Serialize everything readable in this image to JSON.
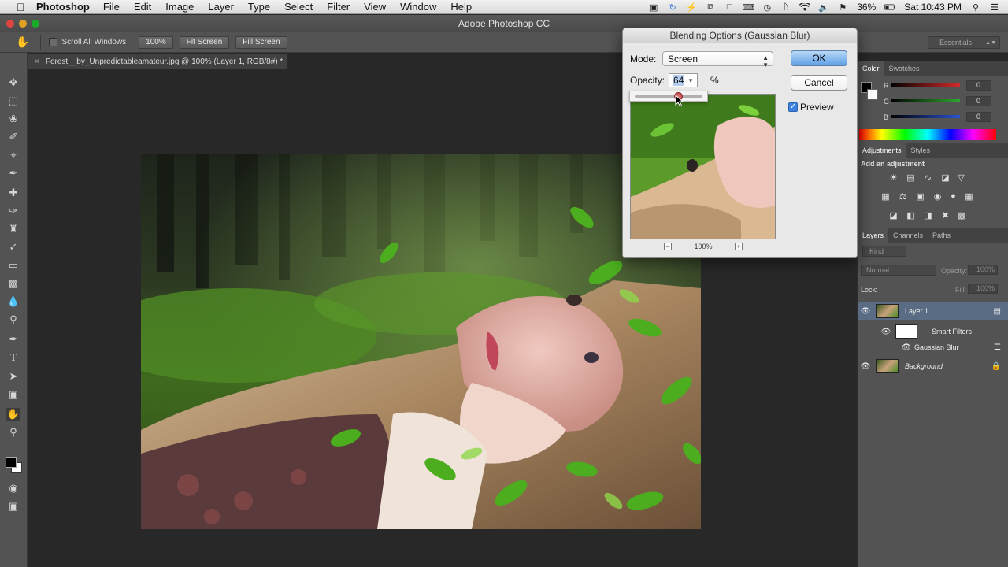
{
  "menubar": {
    "app": "Photoshop",
    "items": [
      "File",
      "Edit",
      "Image",
      "Layer",
      "Type",
      "Select",
      "Filter",
      "View",
      "Window",
      "Help"
    ],
    "battery": "36%",
    "clock": "Sat 10:43 PM"
  },
  "window": {
    "title": "Adobe Photoshop CC"
  },
  "options_bar": {
    "scroll_all_windows": "Scroll All Windows",
    "zoom_100": "100%",
    "fit_screen": "Fit Screen",
    "fill_screen": "Fill Screen",
    "workspace": "Essentials"
  },
  "document": {
    "tab_title": "Forest__by_Unpredictableamateur.jpg @ 100% (Layer 1, RGB/8#) *"
  },
  "dialog": {
    "title": "Blending Options (Gaussian Blur)",
    "mode_label": "Mode:",
    "mode_value": "Screen",
    "opacity_label": "Opacity:",
    "opacity_value": "64",
    "percent_sign": "%",
    "ok_label": "OK",
    "cancel_label": "Cancel",
    "preview_label": "Preview",
    "preview_checked": true,
    "zoom_level": "100%",
    "opacity_slider_fraction": 0.64
  },
  "color_panel": {
    "tabs": [
      "Color",
      "Swatches"
    ],
    "channels": [
      {
        "label": "R",
        "value": "0",
        "color": "#d42a2a"
      },
      {
        "label": "G",
        "value": "0",
        "color": "#2ea82e"
      },
      {
        "label": "B",
        "value": "0",
        "color": "#2a52d4"
      }
    ]
  },
  "adjustments_panel": {
    "tabs": [
      "Adjustments",
      "Styles"
    ],
    "heading": "Add an adjustment"
  },
  "layers_panel": {
    "tabs": [
      "Layers",
      "Channels",
      "Paths"
    ],
    "kind_label": "Kind",
    "blend_mode": "Normal",
    "opacity_label": "Opacity:",
    "opacity_value": "100%",
    "lock_label": "Lock:",
    "fill_label": "Fill:",
    "fill_value": "100%",
    "layers": [
      {
        "name": "Layer 1",
        "selected": true
      },
      {
        "name": "Smart Filters"
      },
      {
        "name": "Gaussian Blur"
      },
      {
        "name": "Background"
      }
    ]
  },
  "colors": {
    "ok_blue": "#5ea0e6",
    "panel_bg": "#535353",
    "canvas_bg": "#282828"
  }
}
